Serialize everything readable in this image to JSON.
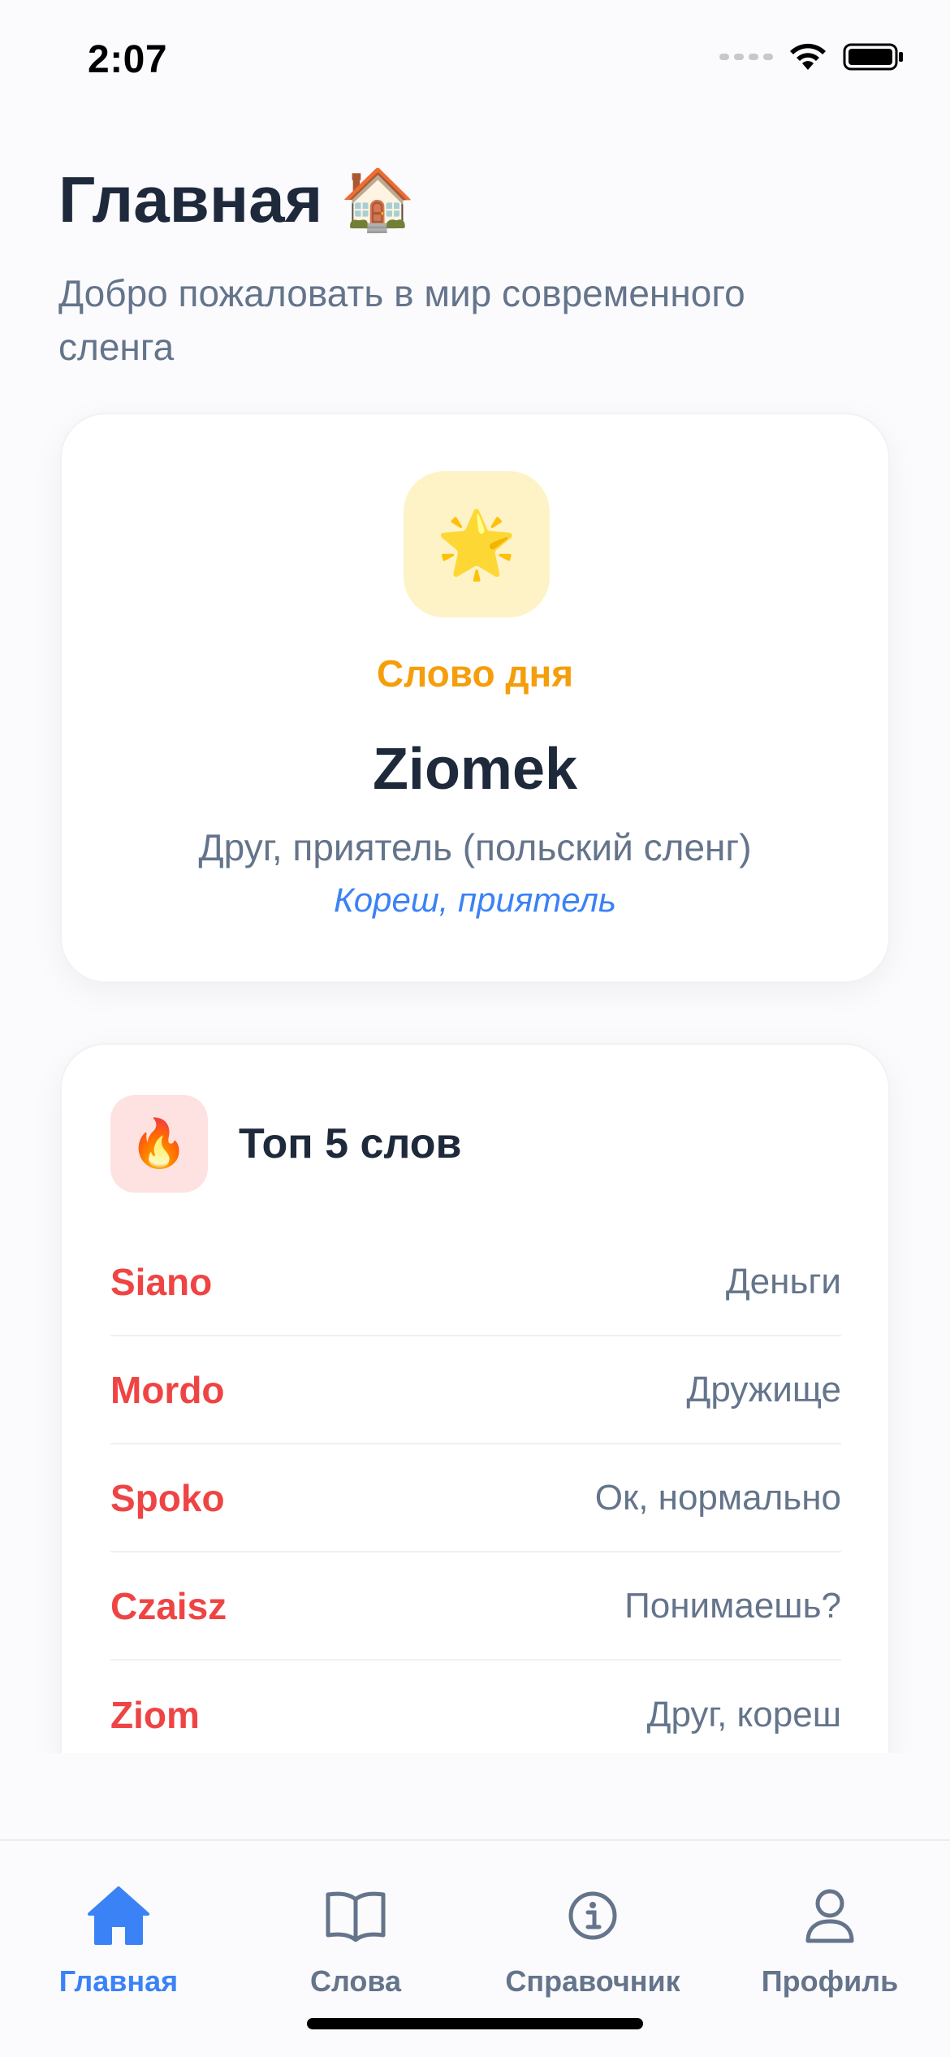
{
  "status_bar": {
    "time": "2:07"
  },
  "header": {
    "title": "Главная",
    "title_emoji": "🏠",
    "subtitle": "Добро пожаловать в мир современного сленга"
  },
  "word_of_day": {
    "icon_emoji": "🌟",
    "label": "Слово дня",
    "word": "Ziomek",
    "meaning": "Друг, приятель (польский сленг)",
    "translation": "Кореш, приятель"
  },
  "top_words": {
    "icon_emoji": "🔥",
    "title": "Топ 5 слов",
    "items": [
      {
        "word": "Siano",
        "translation": "Деньги"
      },
      {
        "word": "Mordo",
        "translation": "Дружище"
      },
      {
        "word": "Spoko",
        "translation": "Ок, нормально"
      },
      {
        "word": "Czaisz",
        "translation": "Понимаешь?"
      },
      {
        "word": "Ziom",
        "translation": "Друг, кореш"
      }
    ]
  },
  "tab_bar": {
    "tabs": [
      {
        "label": "Главная",
        "icon": "house-icon",
        "active": true
      },
      {
        "label": "Слова",
        "icon": "book-icon",
        "active": false
      },
      {
        "label": "Справочник",
        "icon": "info-icon",
        "active": false
      },
      {
        "label": "Профиль",
        "icon": "person-icon",
        "active": false
      }
    ]
  },
  "colors": {
    "accent": "#3b82f6",
    "word_of_day_label": "#f59e0b",
    "top_word": "#ef4444",
    "muted": "#64748b",
    "title": "#1e293b"
  }
}
